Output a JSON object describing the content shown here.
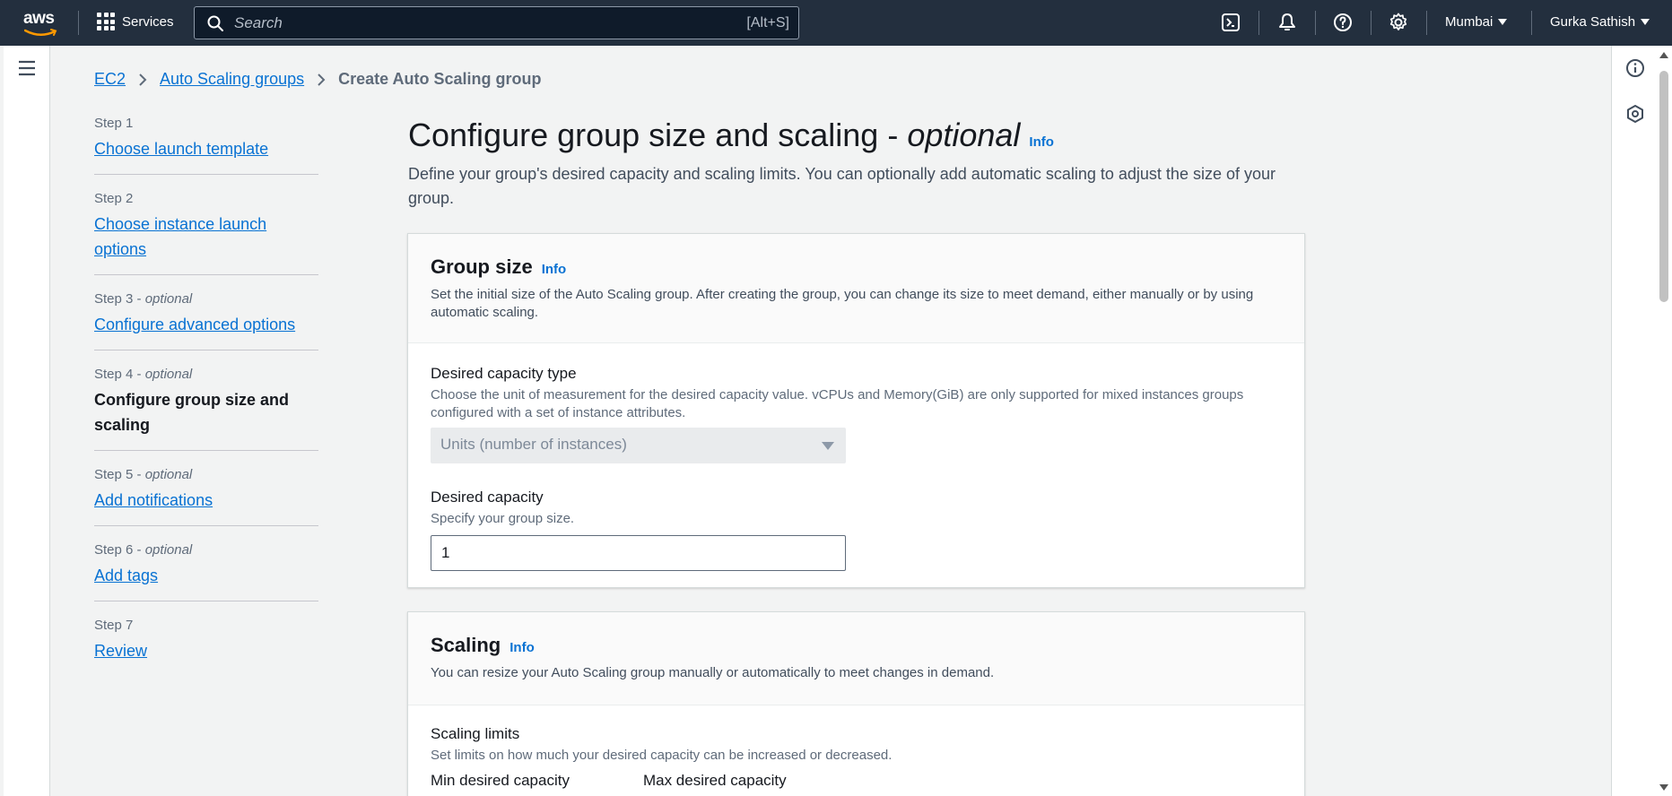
{
  "nav": {
    "logo_text": "aws",
    "services_label": "Services",
    "search_placeholder": "Search",
    "search_shortcut": "[Alt+S]",
    "region": "Mumbai",
    "user": "Gurka Sathish",
    "icons": [
      "cloudshell-icon",
      "notifications-bell-icon",
      "help-icon",
      "settings-gear-icon"
    ]
  },
  "breadcrumb": {
    "items": [
      "EC2",
      "Auto Scaling groups"
    ],
    "current": "Create Auto Scaling group"
  },
  "steps": [
    {
      "label": "Step 1",
      "optional": "",
      "title": "Choose launch template",
      "current": false
    },
    {
      "label": "Step 2",
      "optional": "",
      "title": "Choose instance launch options",
      "current": false
    },
    {
      "label": "Step 3",
      "optional": "optional",
      "title": "Configure advanced options",
      "current": false
    },
    {
      "label": "Step 4",
      "optional": "optional",
      "title": "Configure group size and scaling",
      "current": true
    },
    {
      "label": "Step 5",
      "optional": "optional",
      "title": "Add notifications",
      "current": false
    },
    {
      "label": "Step 6",
      "optional": "optional",
      "title": "Add tags",
      "current": false
    },
    {
      "label": "Step 7",
      "optional": "",
      "title": "Review",
      "current": false
    }
  ],
  "page": {
    "title": "Configure group size and scaling - ",
    "title_optional": "optional",
    "info": "Info",
    "description": "Define your group's desired capacity and scaling limits. You can optionally add automatic scaling to adjust the size of your group."
  },
  "group_size": {
    "title": "Group size",
    "info": "Info",
    "description": "Set the initial size of the Auto Scaling group. After creating the group, you can change its size to meet demand, either manually or by using automatic scaling.",
    "capacity_type_label": "Desired capacity type",
    "capacity_type_desc": "Choose the unit of measurement for the desired capacity value. vCPUs and Memory(GiB) are only supported for mixed instances groups configured with a set of instance attributes.",
    "capacity_type_value": "Units (number of instances)",
    "desired_label": "Desired capacity",
    "desired_desc": "Specify your group size.",
    "desired_value": "1"
  },
  "scaling": {
    "title": "Scaling",
    "info": "Info",
    "description": "You can resize your Auto Scaling group manually or automatically to meet changes in demand.",
    "limits_label": "Scaling limits",
    "limits_desc": "Set limits on how much your desired capacity can be increased or decreased.",
    "min_label": "Min desired capacity",
    "max_label": "Max desired capacity"
  }
}
